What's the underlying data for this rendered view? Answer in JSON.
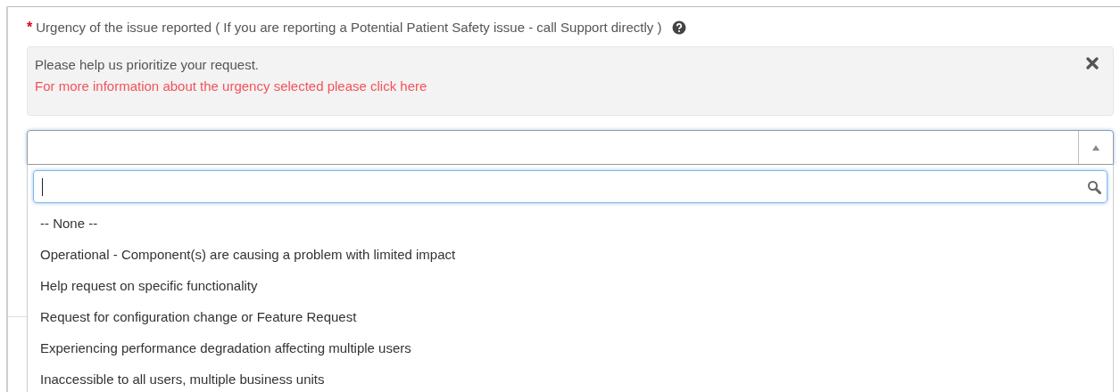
{
  "field": {
    "required_mark": "*",
    "label": "Urgency of the issue reported ( If you are reporting a Potential Patient Safety issue - call Support directly )"
  },
  "info": {
    "text": "Please help us prioritize your request.",
    "link": "For more information about the urgency selected please click here"
  },
  "select": {
    "expanded": true
  },
  "options": [
    {
      "label": "-- None --"
    },
    {
      "label": "Operational - Component(s) are causing a problem with limited impact"
    },
    {
      "label": "Help request on specific functionality"
    },
    {
      "label": "Request for configuration change or Feature Request"
    },
    {
      "label": "Experiencing performance degradation affecting multiple users"
    },
    {
      "label": "Inaccessible to all users, multiple business units"
    }
  ]
}
